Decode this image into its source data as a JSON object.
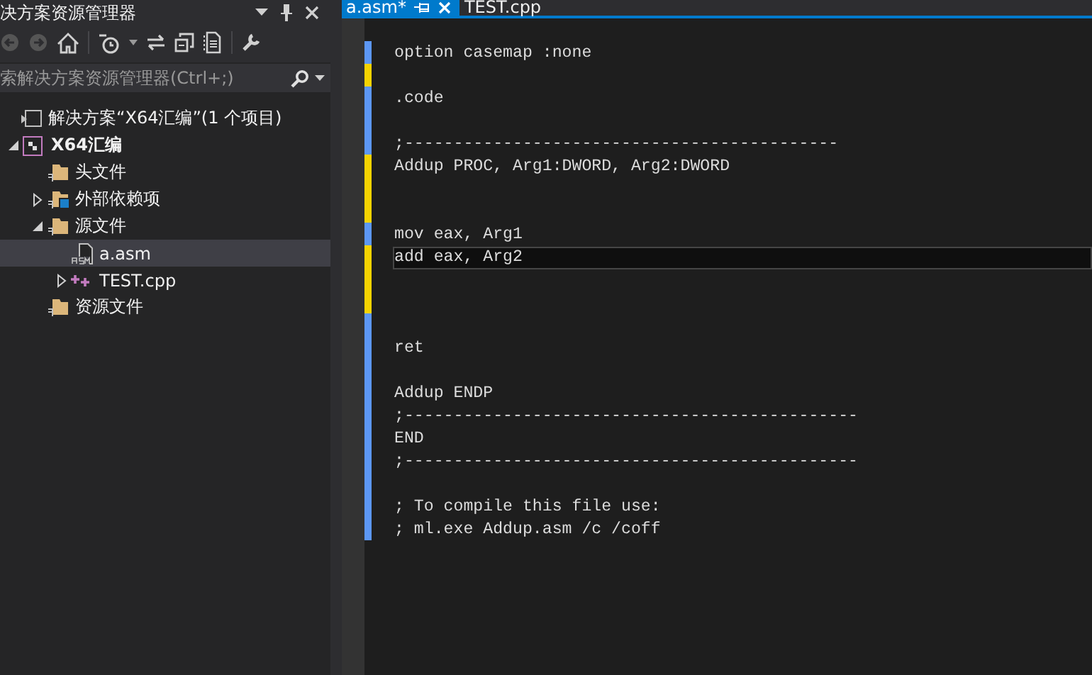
{
  "solution_explorer": {
    "title": "决方案资源管理器",
    "search": {
      "placeholder": "索解决方案资源管理器(Ctrl+;)"
    },
    "tree": [
      {
        "label": "解决方案“X64汇编”(1 个项目)",
        "kind": "solution",
        "selected": false,
        "children": [
          {
            "label": "X64汇编",
            "kind": "project",
            "bold": true,
            "expanded": true,
            "selected": false,
            "children": [
              {
                "label": "头文件",
                "kind": "folder",
                "selected": false
              },
              {
                "label": "外部依赖项",
                "kind": "references",
                "expanded": false,
                "selected": false
              },
              {
                "label": "源文件",
                "kind": "folder",
                "expanded": true,
                "selected": false,
                "children": [
                  {
                    "label": "a.asm",
                    "kind": "asm",
                    "selected": true
                  },
                  {
                    "label": "TEST.cpp",
                    "kind": "cpp",
                    "expanded": false,
                    "selected": false
                  }
                ]
              },
              {
                "label": "资源文件",
                "kind": "folder",
                "selected": false
              }
            ]
          }
        ]
      }
    ]
  },
  "editor": {
    "tabs": [
      {
        "label": "a.asm*",
        "selected": true
      },
      {
        "label": "TEST.cpp",
        "selected": false
      }
    ],
    "lines": [
      {
        "text": "option casemap :none",
        "color": "#5c97f5",
        "current": false
      },
      {
        "color": "#f5d300",
        "current": false
      },
      {
        "text": ".code",
        "color": "#5c97f5",
        "current": false
      },
      {
        "color": "#5c97f5",
        "current": false
      },
      {
        "text": ";--------------------------------------------",
        "color": "#5c97f5",
        "current": false
      },
      {
        "text": "Addup PROC, Arg1:DWORD, Arg2:DWORD",
        "color": "#f5d300",
        "current": false
      },
      {
        "color": "#f5d300",
        "current": false
      },
      {
        "color": "#f5d300",
        "current": false
      },
      {
        "text": "mov eax, Arg1",
        "color": "#5c97f5",
        "current": false
      },
      {
        "text": "add eax, Arg2",
        "color": "#f5d300",
        "current": true
      },
      {
        "color": "#f5d300",
        "current": false
      },
      {
        "color": "#f5d300",
        "current": false
      },
      {
        "color": "#5c97f5",
        "current": false
      },
      {
        "text": "ret",
        "color": "#5c97f5",
        "current": false
      },
      {
        "color": "#5c97f5",
        "current": false
      },
      {
        "text": "Addup ENDP",
        "color": "#5c97f5",
        "current": false
      },
      {
        "text": ";----------------------------------------------",
        "color": "#5c97f5",
        "current": false
      },
      {
        "text": "END",
        "color": "#5c97f5",
        "current": false
      },
      {
        "text": ";----------------------------------------------",
        "color": "#5c97f5",
        "current": false
      },
      {
        "color": "#5c97f5",
        "current": false
      },
      {
        "text": "; To compile this file use:",
        "color": "#5c97f5",
        "current": false
      },
      {
        "text": "; ml.exe Addup.asm /c /coff",
        "color": "#5c97f5",
        "current": false
      }
    ]
  }
}
